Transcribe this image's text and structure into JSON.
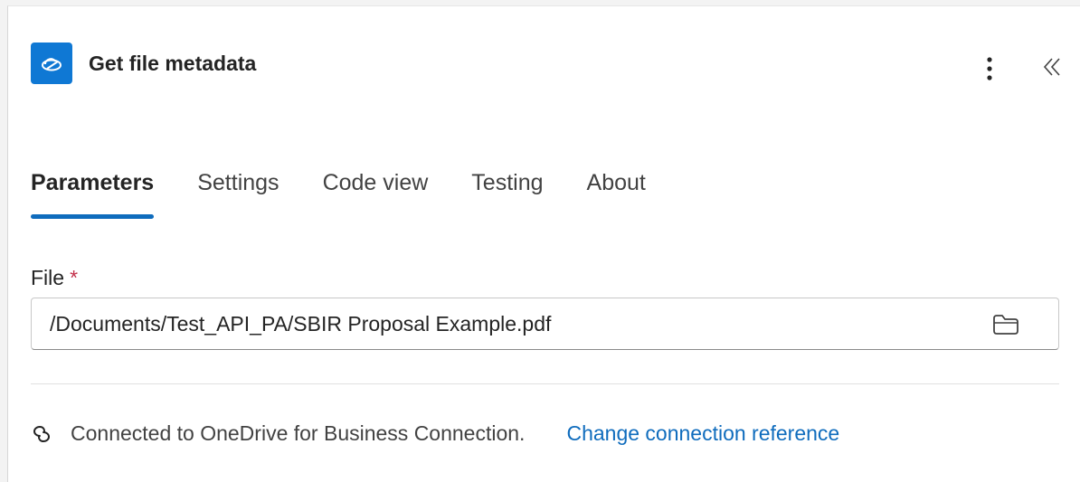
{
  "header": {
    "title": "Get file metadata",
    "app_icon": "onedrive-cloud-icon",
    "more_icon": "more-vertical-icon",
    "collapse_icon": "chevron-double-left-icon",
    "accent_color": "#0f78d4"
  },
  "tabs": [
    {
      "label": "Parameters",
      "active": true
    },
    {
      "label": "Settings",
      "active": false
    },
    {
      "label": "Code view",
      "active": false
    },
    {
      "label": "Testing",
      "active": false
    },
    {
      "label": "About",
      "active": false
    }
  ],
  "file_field": {
    "label": "File",
    "required_mark": "*",
    "value": "/Documents/Test_API_PA/SBIR Proposal Example.pdf",
    "picker_icon": "folder-icon"
  },
  "connection": {
    "icon": "link-icon",
    "status_text": "Connected to OneDrive for Business Connection.",
    "change_link": "Change connection reference",
    "link_color": "#0f6cbd"
  }
}
